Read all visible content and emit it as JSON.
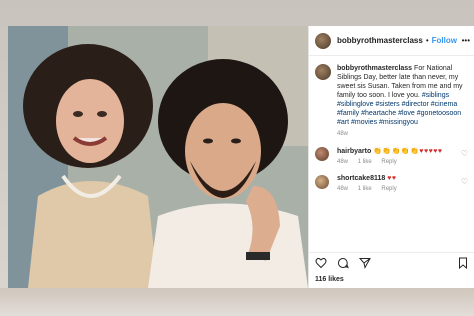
{
  "post": {
    "username": "bobbyrothmasterclass",
    "follow_label": "Follow",
    "separator": "•",
    "caption_user": "bobbyrothmasterclass",
    "caption_text": "For National Siblings Day, better late than never, my sweet sis Susan. Taken from me and my family too soon. I love you.",
    "caption_tags": "#siblings #siblinglove #sisters #director #cinema #family #heartache #love #gonetoosoon #art #movies #missingyou",
    "time_ago": "48w",
    "likes": "116 likes"
  },
  "comments": [
    {
      "user": "hairbyarto",
      "emoji_clap": "👏👏👏👏👏",
      "emoji_hearts": "♥♥♥♥♥",
      "time": "48w",
      "likes": "1 like",
      "reply": "Reply"
    },
    {
      "user": "shortcake8118",
      "emoji_hearts": "♥♥",
      "time": "48w",
      "likes": "1 like",
      "reply": "Reply"
    }
  ],
  "icons": {
    "heart": "heart-icon",
    "comment": "comment-icon",
    "share": "share-icon",
    "save": "bookmark-icon",
    "more": "more-icon"
  },
  "colors": {
    "link_blue": "#3897f0",
    "tag_blue": "#00376b",
    "heart_red": "#d32f2f"
  }
}
